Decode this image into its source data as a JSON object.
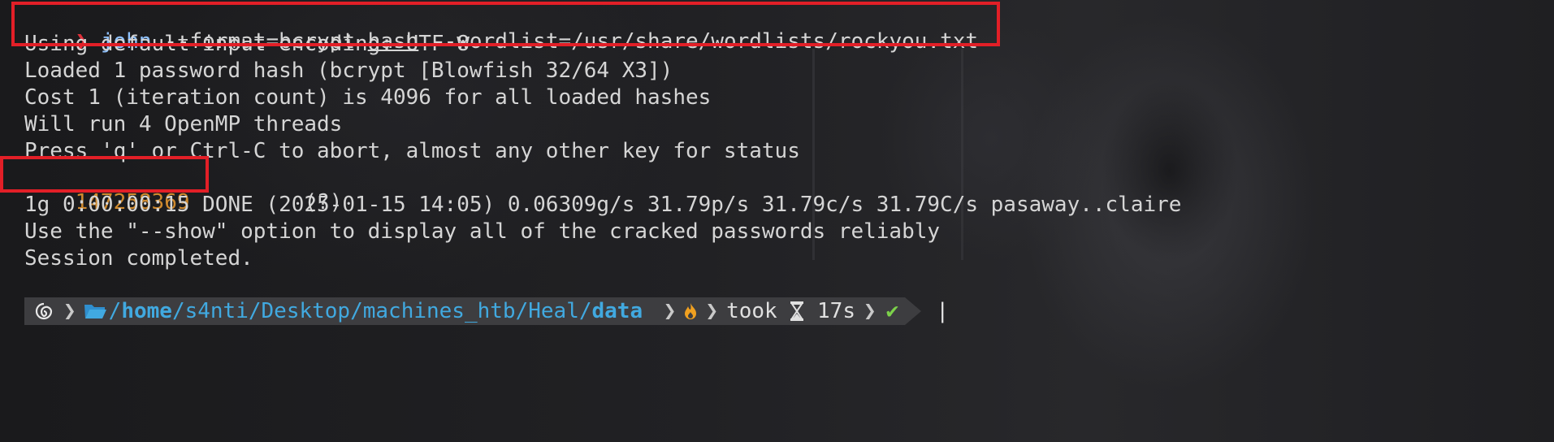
{
  "command": {
    "prompt_symbol": "❯",
    "program": "john",
    "arg1": " --format=bcrypt ",
    "arg_file": "hash",
    "arg2": " --wordlist=/usr/share/wordlists/rockyou.txt"
  },
  "output": [
    "Using default input encoding: UTF-8",
    "Loaded 1 password hash (bcrypt [Blowfish 32/64 X3])",
    "Cost 1 (iteration count) is 4096 for all loaded hashes",
    "Will run 4 OpenMP threads",
    "Press 'q' or Ctrl-C to abort, almost any other key for status"
  ],
  "cracked": {
    "password": "147258369",
    "user": "(?)"
  },
  "output_after": [
    "1g 0:00:00:15 DONE (2025-01-15 14:05) 0.06309g/s 31.79p/s 31.79c/s 31.79C/s pasaway..claire",
    "Use the \"--show\" option to display all of the cracked passwords reliably",
    "Session completed."
  ],
  "prompt": {
    "os_icon": "debian-swirl-icon",
    "folder_icon": "folder-open-icon",
    "path_sep1": "/",
    "path_home": "home",
    "path_mid": "/s4nti/Desktop/machines_htb/Heal/",
    "path_last": "data",
    "status_icon": "flame-icon",
    "took_label": "took",
    "hourglass_icon": "hourglass-icon",
    "duration": "17s",
    "success_mark": "✔",
    "cursor": "|"
  },
  "colors": {
    "highlight": "#e21f27",
    "cracked_text": "#d08a2e",
    "path": "#41a9e0",
    "prompt_symbol": "#e0303a"
  }
}
